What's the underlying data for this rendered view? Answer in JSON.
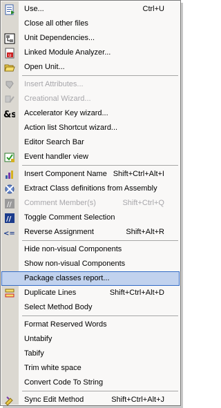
{
  "menu": {
    "items": [
      {
        "type": "item",
        "label": "Use...",
        "shortcut": "Ctrl+U",
        "icon": "use-unit-icon",
        "enabled": true
      },
      {
        "type": "item",
        "label": "Close all other files",
        "shortcut": "",
        "icon": "",
        "enabled": true
      },
      {
        "type": "item",
        "label": "Unit Dependencies...",
        "shortcut": "",
        "icon": "unit-dependencies-icon",
        "enabled": true
      },
      {
        "type": "item",
        "label": "Linked Module Analyzer...",
        "shortcut": "",
        "icon": "module-analyzer-icon",
        "enabled": true
      },
      {
        "type": "item",
        "label": "Open Unit...",
        "shortcut": "",
        "icon": "open-folder-icon",
        "enabled": true
      },
      {
        "type": "sep"
      },
      {
        "type": "item",
        "label": "Insert Attributes...",
        "shortcut": "",
        "icon": "insert-attributes-icon",
        "enabled": false
      },
      {
        "type": "item",
        "label": "Creational Wizard...",
        "shortcut": "",
        "icon": "creational-wizard-icon",
        "enabled": false
      },
      {
        "type": "item",
        "label": "Accelerator Key wizard...",
        "shortcut": "",
        "icon": "accelerator-key-icon",
        "enabled": true
      },
      {
        "type": "item",
        "label": "Action list Shortcut wizard...",
        "shortcut": "",
        "icon": "",
        "enabled": true
      },
      {
        "type": "item",
        "label": "Editor Search Bar",
        "shortcut": "",
        "icon": "",
        "enabled": true
      },
      {
        "type": "item",
        "label": "Event handler view",
        "shortcut": "",
        "icon": "event-handler-icon",
        "enabled": true
      },
      {
        "type": "sep"
      },
      {
        "type": "item",
        "label": "Insert Component Name",
        "shortcut": "Shift+Ctrl+Alt+I",
        "icon": "insert-component-icon",
        "enabled": true
      },
      {
        "type": "item",
        "label": "Extract Class definitions from Assembly",
        "shortcut": "",
        "icon": "extract-class-icon",
        "enabled": true
      },
      {
        "type": "item",
        "label": "Comment Member(s)",
        "shortcut": "Shift+Ctrl+Q",
        "icon": "comment-member-icon",
        "enabled": false
      },
      {
        "type": "item",
        "label": "Toggle Comment Selection",
        "shortcut": "",
        "icon": "toggle-comment-icon",
        "enabled": true
      },
      {
        "type": "item",
        "label": "Reverse Assignment",
        "shortcut": "Shift+Alt+R",
        "icon": "reverse-assignment-icon",
        "enabled": true
      },
      {
        "type": "sep"
      },
      {
        "type": "item",
        "label": "Hide non-visual Components",
        "shortcut": "",
        "icon": "",
        "enabled": true
      },
      {
        "type": "item",
        "label": "Show non-visual Components",
        "shortcut": "",
        "icon": "",
        "enabled": true
      },
      {
        "type": "item",
        "label": "Package classes report...",
        "shortcut": "",
        "icon": "",
        "enabled": true,
        "highlighted": true
      },
      {
        "type": "item",
        "label": "Duplicate Lines",
        "shortcut": "Shift+Ctrl+Alt+D",
        "icon": "duplicate-lines-icon",
        "enabled": true
      },
      {
        "type": "item",
        "label": "Select Method Body",
        "shortcut": "",
        "icon": "",
        "enabled": true
      },
      {
        "type": "sep"
      },
      {
        "type": "item",
        "label": "Format Reserved Words",
        "shortcut": "",
        "icon": "",
        "enabled": true
      },
      {
        "type": "item",
        "label": "Untabify",
        "shortcut": "",
        "icon": "",
        "enabled": true
      },
      {
        "type": "item",
        "label": "Tabify",
        "shortcut": "",
        "icon": "",
        "enabled": true
      },
      {
        "type": "item",
        "label": "Trim white space",
        "shortcut": "",
        "icon": "",
        "enabled": true
      },
      {
        "type": "item",
        "label": "Convert Code To String",
        "shortcut": "",
        "icon": "",
        "enabled": true
      },
      {
        "type": "sep"
      },
      {
        "type": "item",
        "label": "Sync Edit Method",
        "shortcut": "Shift+Ctrl+Alt+J",
        "icon": "sync-edit-icon",
        "enabled": true
      }
    ]
  },
  "colors": {
    "gutter": "#dbd8d1",
    "menu_background": "#f9f8f7",
    "highlight": "#c1d2ee",
    "highlight_border": "#316ac5",
    "disabled_text": "#a7a6aa"
  }
}
